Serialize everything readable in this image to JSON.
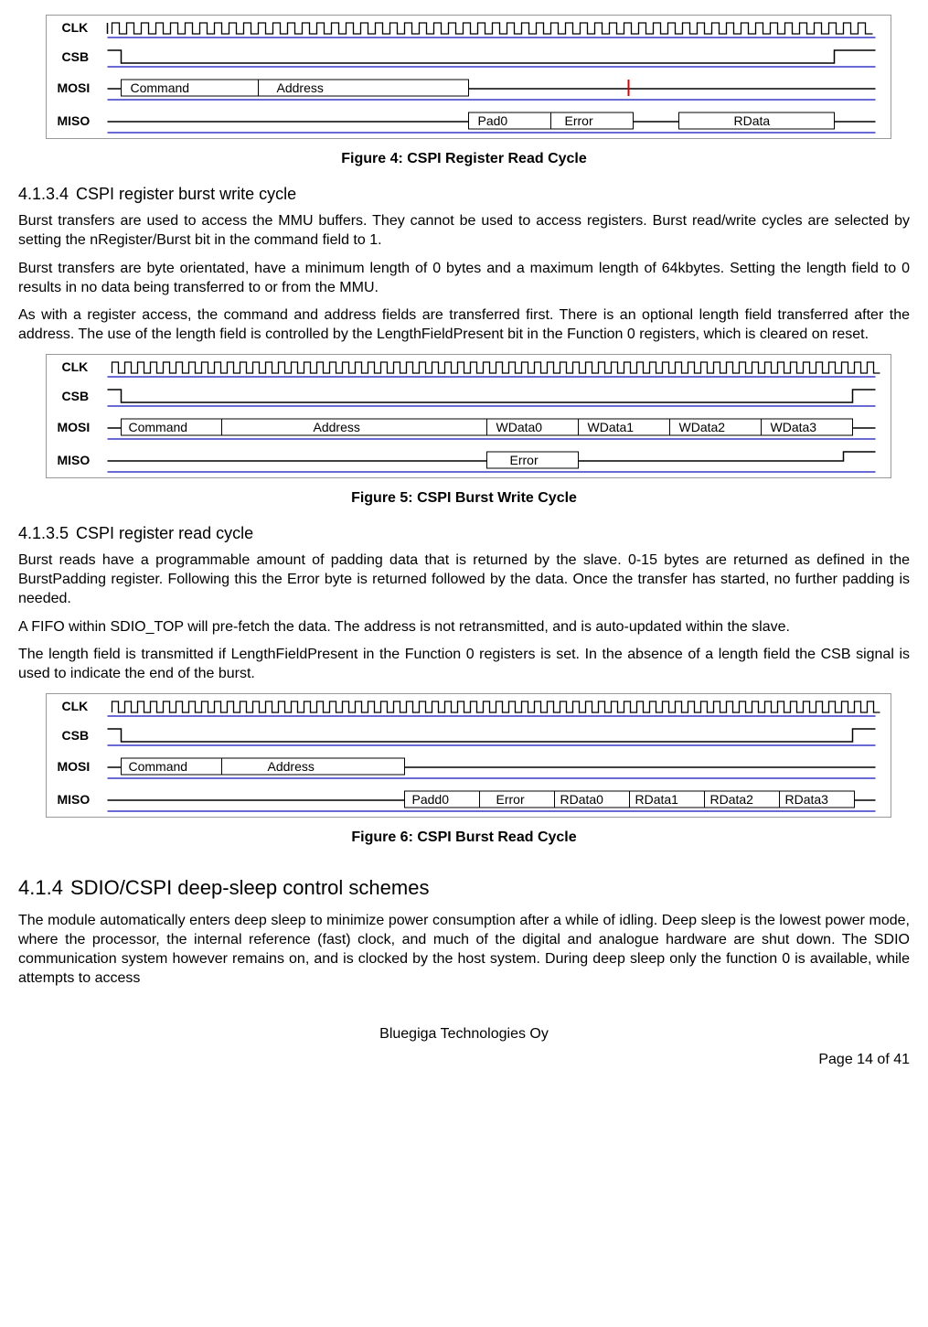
{
  "figures": {
    "fig4": {
      "caption": "Figure 4: CSPI Register Read Cycle",
      "signals": [
        "CLK",
        "CSB",
        "MOSI",
        "MISO"
      ],
      "mosi": [
        "Command",
        "Address"
      ],
      "miso": [
        "Pad0",
        "Error",
        "RData"
      ]
    },
    "fig5": {
      "caption": "Figure 5: CSPI Burst Write Cycle",
      "signals": [
        "CLK",
        "CSB",
        "MOSI",
        "MISO"
      ],
      "mosi": [
        "Command",
        "Address",
        "WData0",
        "WData1",
        "WData2",
        "WData3"
      ],
      "miso": [
        "Error"
      ]
    },
    "fig6": {
      "caption": "Figure 6: CSPI Burst Read Cycle",
      "signals": [
        "CLK",
        "CSB",
        "MOSI",
        "MISO"
      ],
      "mosi": [
        "Command",
        "Address"
      ],
      "miso": [
        "Padd0",
        "Error",
        "RData0",
        "RData1",
        "RData2",
        "RData3"
      ]
    }
  },
  "sections": {
    "s4134": {
      "num": "4.1.3.4",
      "title": "CSPI register burst write cycle",
      "p1": "Burst transfers are used to access the MMU buffers. They cannot be used to access registers. Burst read/write cycles are selected by setting the nRegister/Burst bit in the command field to 1.",
      "p2": "Burst transfers are byte orientated, have a minimum length of 0 bytes and a maximum length of 64kbytes. Setting the length field to 0 results in no data being transferred to or from the MMU.",
      "p3": "As with a register access, the command and address fields are transferred first. There is an optional length field transferred after the address. The use of the length field is controlled by the LengthFieldPresent bit in the Function 0 registers, which is cleared on reset."
    },
    "s4135": {
      "num": "4.1.3.5",
      "title": "CSPI register read cycle",
      "p1": "Burst reads have a programmable amount of padding data that is returned by the slave. 0-15 bytes are returned as defined in the BurstPadding register. Following this the Error byte is returned followed by the data. Once the transfer has started, no further padding is needed.",
      "p2": "A FIFO within SDIO_TOP will pre-fetch the data. The address is not retransmitted, and is auto-updated within the slave.",
      "p3": "The length field is transmitted if LengthFieldPresent in the Function 0 registers is set. In the absence of a length field the CSB signal is used to indicate the end of the burst."
    },
    "s414": {
      "num": "4.1.4",
      "title": "SDIO/CSPI deep-sleep control schemes",
      "p1": "The module automatically enters deep sleep to minimize power consumption after a while of idling. Deep sleep is the lowest power mode, where the processor, the internal reference (fast) clock, and much of the digital and analogue hardware are shut down. The SDIO communication system however remains on, and is clocked by the host system. During deep sleep only the function 0 is available, while attempts to access"
    }
  },
  "footer": {
    "company": "Bluegiga Technologies Oy",
    "page": "Page 14 of 41"
  }
}
